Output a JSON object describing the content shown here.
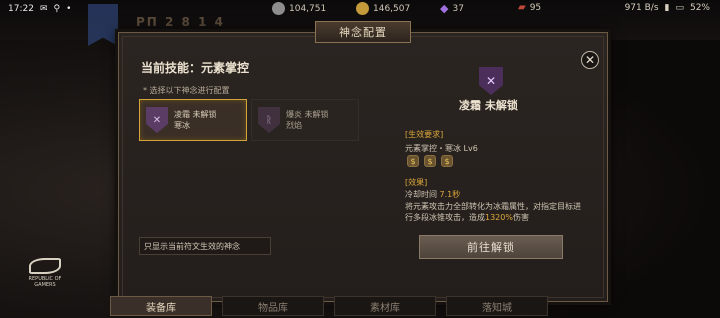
{
  "status": {
    "time": "17:22",
    "net_speed": "971 B/s",
    "battery": "52%"
  },
  "background": {
    "level_text": "ΡΠ 2 8 1 4"
  },
  "currency": [
    {
      "icon": "silver-coin-icon",
      "value": "104,751",
      "color": "#9a9a9a"
    },
    {
      "icon": "gold-coin-icon",
      "value": "146,507",
      "color": "#c49a3a"
    },
    {
      "icon": "gem-icon",
      "value": "37",
      "color": "#a070e0"
    },
    {
      "icon": "ticket-icon",
      "value": "95",
      "color": "#c04a3a"
    }
  ],
  "dialog": {
    "title": "神念配置",
    "close_label": "✕",
    "current_skill": "当前技能：元素掌控",
    "hint": "* 选择以下神念进行配置",
    "cards": [
      {
        "line1": "凌霜 未解锁",
        "line2": "寒冰"
      },
      {
        "line1": "爆炎 未解锁",
        "line2": "烈焰"
      }
    ],
    "filter_label": "只显示当前符文生效的神念",
    "detail": {
      "title": "凌霜 未解锁",
      "req_label": "[生效要求]",
      "req_text": "元素掌控・寒冰 Lv6",
      "tokens": [
        "$",
        "$",
        "$"
      ],
      "effect_label": "[效果]",
      "cooldown_label": "冷却时间",
      "cooldown_value": "7.1秒",
      "desc_part1": "将元素攻击力全部转化为冰霜属性，对指定目标进行多段冰锥攻击，造成",
      "desc_highlight": "1320%",
      "desc_part2": "伤害"
    },
    "unlock_button": "前往解锁"
  },
  "bottom_nav": [
    {
      "label": "装备库",
      "active": true
    },
    {
      "label": "物品库",
      "active": false
    },
    {
      "label": "素材库",
      "active": false
    },
    {
      "label": "落知城",
      "active": false
    }
  ],
  "brand": {
    "line1": "REPUBLIC OF",
    "line2": "GAMERS"
  }
}
